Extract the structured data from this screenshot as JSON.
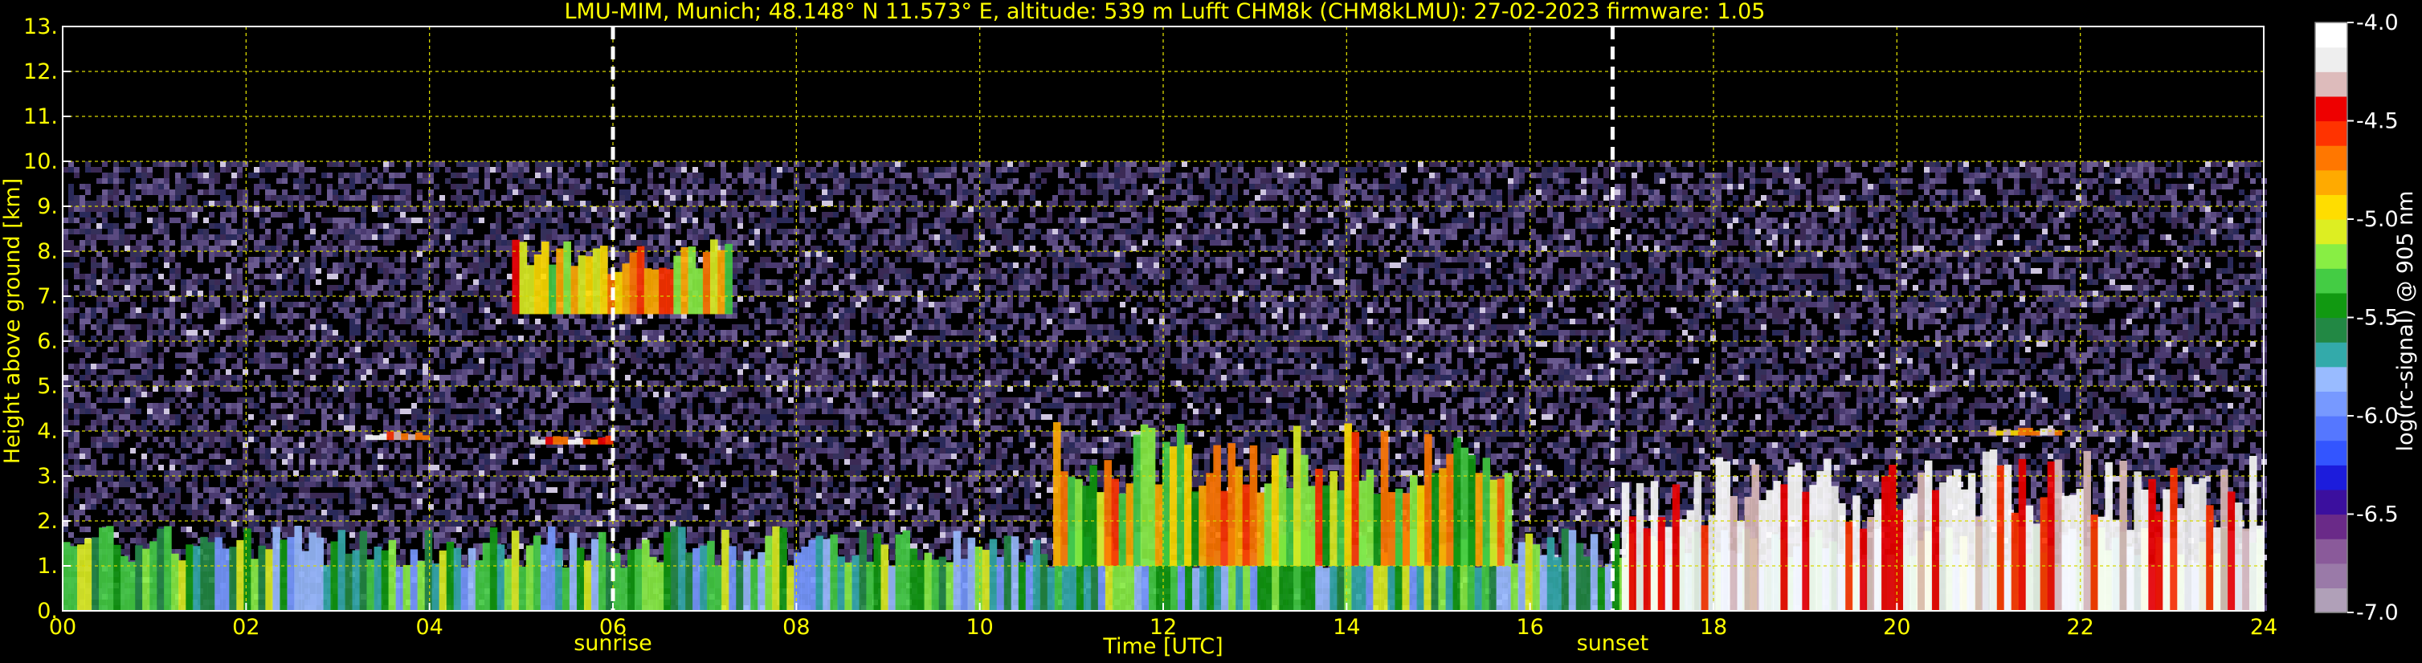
{
  "chart_data": {
    "type": "heatmap",
    "title": "LMU-MIM, Munich; 48.148° N 11.573° E, altitude: 539 m    Lufft CHM8k (CHM8kLMU): 27-02-2023    firmware: 1.05",
    "xlabel": "Time [UTC]",
    "ylabel": "Height above ground [km]",
    "xlim": [
      0,
      24
    ],
    "ylim": [
      0,
      13
    ],
    "x_ticks": [
      0,
      2,
      4,
      6,
      8,
      10,
      12,
      14,
      16,
      18,
      20,
      22,
      24
    ],
    "x_tick_labels": [
      "00",
      "02",
      "04",
      "06",
      "08",
      "10",
      "12",
      "14",
      "16",
      "18",
      "20",
      "22",
      "24"
    ],
    "y_ticks": [
      0,
      1,
      2,
      3,
      4,
      5,
      6,
      7,
      8,
      9,
      10,
      11,
      12,
      13
    ],
    "y_tick_labels": [
      "0.",
      "1.",
      "2.",
      "3.",
      "4.",
      "5.",
      "6.",
      "7.",
      "8.",
      "9.",
      "10.",
      "11.",
      "12.",
      "13."
    ],
    "grid": true,
    "data_top_km": 10,
    "events": [
      {
        "label": "sunrise",
        "time": 6.0
      },
      {
        "label": "sunset",
        "time": 16.9
      }
    ],
    "colorbar": {
      "label": "log(rc-signal) @ 905 nm",
      "range": [
        -7.0,
        -4.0
      ],
      "ticks": [
        -4.0,
        -4.5,
        -5.0,
        -5.5,
        -6.0,
        -6.5,
        -7.0
      ],
      "tick_labels": [
        "-4.0",
        "-4.5",
        "-5.0",
        "-5.5",
        "-6.0",
        "-6.5",
        "-7.0"
      ],
      "colors": [
        "#b0a0b8",
        "#9a7aa8",
        "#8a5a9a",
        "#6a2a88",
        "#3b0f9e",
        "#1c1cdc",
        "#3355ff",
        "#5577ff",
        "#7799ff",
        "#99bbff",
        "#33aaaa",
        "#228844",
        "#119911",
        "#44cc44",
        "#88ee44",
        "#ddee22",
        "#ffdd00",
        "#ffaa00",
        "#ff7700",
        "#ff3300",
        "#ee0000",
        "#ddbbbb",
        "#eeeeee",
        "#ffffff"
      ]
    },
    "features": [
      {
        "type": "boundary_layer",
        "time_start": 0.0,
        "time_end": 24.0,
        "height_km": [
          0.0,
          1.9
        ],
        "log_signal": -5.5
      },
      {
        "type": "cirrus",
        "time_start": 4.9,
        "time_end": 7.3,
        "height_km": [
          6.6,
          8.3
        ],
        "log_signal": -4.9
      },
      {
        "type": "cloud_layer",
        "time_start": 3.3,
        "time_end": 4.0,
        "height_km": [
          3.8,
          4.0
        ],
        "log_signal": -4.4
      },
      {
        "type": "cloud_layer",
        "time_start": 5.1,
        "time_end": 6.0,
        "height_km": [
          3.7,
          3.9
        ],
        "log_signal": -4.4
      },
      {
        "type": "convective_cells",
        "time_start": 10.8,
        "time_end": 15.8,
        "height_km": [
          1.0,
          4.2
        ],
        "log_signal": -5.0
      },
      {
        "type": "dense_aerosol_cloud",
        "time_start": 17.0,
        "time_end": 24.0,
        "height_km": [
          0.0,
          3.6
        ],
        "log_signal": -4.1
      },
      {
        "type": "cloud_layer",
        "time_start": 21.0,
        "time_end": 21.8,
        "height_km": [
          3.9,
          4.1
        ],
        "log_signal": -4.6
      }
    ]
  }
}
